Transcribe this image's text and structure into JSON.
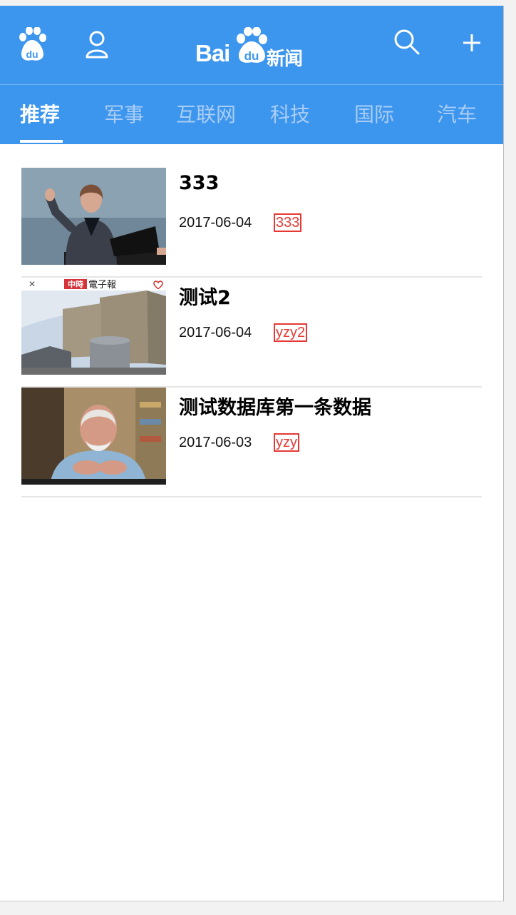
{
  "header": {
    "logo_latin": "Bai",
    "logo_paw_text": "du",
    "logo_cn": "新闻",
    "icons": [
      "paw-icon",
      "user-icon",
      "search-icon",
      "plus-icon"
    ]
  },
  "tabs": [
    {
      "label": "推荐",
      "active": true
    },
    {
      "label": "军事"
    },
    {
      "label": "互联网"
    },
    {
      "label": "科技"
    },
    {
      "label": "国际"
    },
    {
      "label": "汽车"
    }
  ],
  "news": [
    {
      "title": "333",
      "date": "2017-06-04",
      "tag": "333",
      "thumb": "speaker-photo"
    },
    {
      "title": "测试2",
      "date": "2017-06-04",
      "tag": "yzy2",
      "thumb": "building-photo",
      "thumb_banner": "電子報",
      "thumb_banner_brand": "中時"
    },
    {
      "title": "测试数据库第一条数据",
      "date": "2017-06-03",
      "tag": "yzy",
      "thumb": "portrait-photo"
    }
  ],
  "colors": {
    "header_bg": "#3d96ee",
    "tag_red": "#e53935",
    "tab_inactive": "#a9cdf6"
  }
}
